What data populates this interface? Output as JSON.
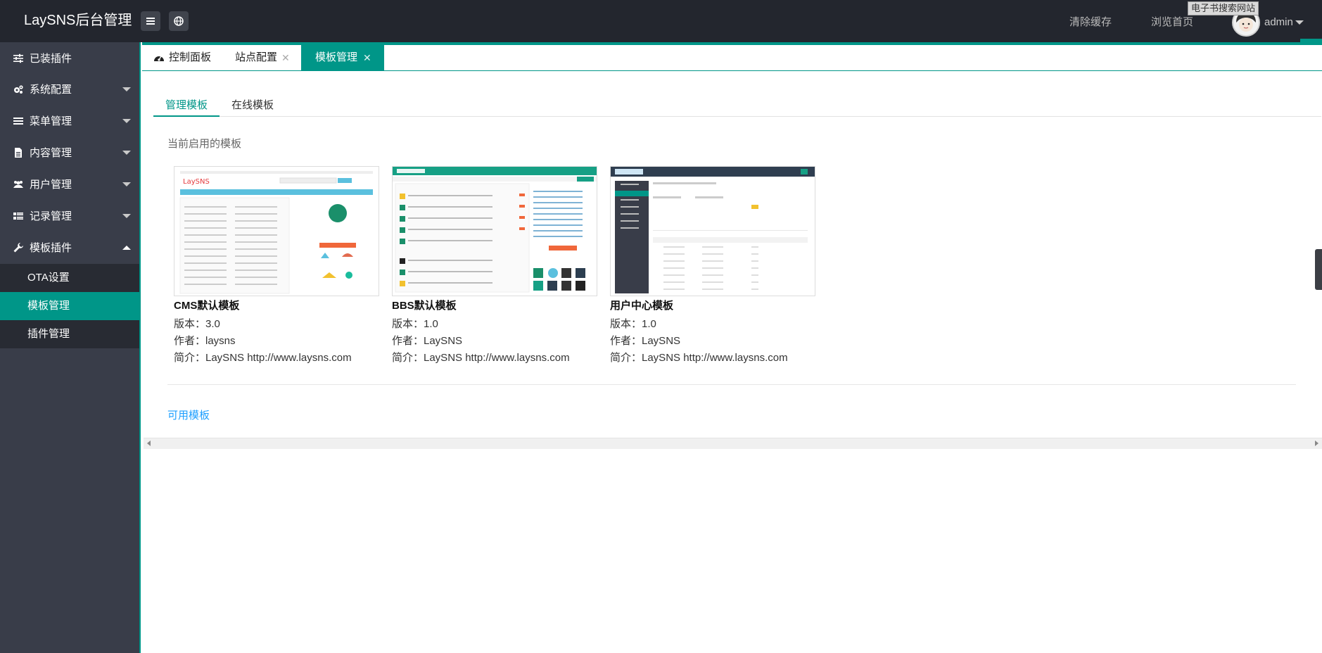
{
  "header": {
    "title": "LaySNS后台管理",
    "clear_cache": "清除缓存",
    "browse_home": "浏览首页",
    "watermark": "电子书搜索网站",
    "user": "admin"
  },
  "sidebar": {
    "items": [
      {
        "label": "已装插件",
        "icon": "sliders-icon",
        "has_caret": false
      },
      {
        "label": "系统配置",
        "icon": "gears-icon",
        "has_caret": true
      },
      {
        "label": "菜单管理",
        "icon": "list-icon",
        "has_caret": true
      },
      {
        "label": "内容管理",
        "icon": "file-icon",
        "has_caret": true
      },
      {
        "label": "用户管理",
        "icon": "users-icon",
        "has_caret": true
      },
      {
        "label": "记录管理",
        "icon": "grid-icon",
        "has_caret": true
      },
      {
        "label": "模板插件",
        "icon": "wrench-icon",
        "has_caret": true,
        "expanded": true
      }
    ],
    "sub_items": [
      {
        "label": "OTA设置",
        "active": false
      },
      {
        "label": "模板管理",
        "active": true
      },
      {
        "label": "插件管理",
        "active": false
      }
    ]
  },
  "tabs": [
    {
      "label": "控制面板",
      "closable": false,
      "active": false
    },
    {
      "label": "站点配置",
      "closable": true,
      "active": false
    },
    {
      "label": "模板管理",
      "closable": true,
      "active": true
    }
  ],
  "subtabs": [
    "管理模板",
    "在线模板"
  ],
  "current_section_title": "当前启用的模板",
  "available_section_title": "可用模板",
  "templates": [
    {
      "name": "CMS默认模板",
      "version": "版本：3.0",
      "author": "作者：laysns",
      "intro": "简介：LaySNS http://www.laysns.com"
    },
    {
      "name": "BBS默认模板",
      "version": "版本：1.0",
      "author": "作者：LaySNS",
      "intro": "简介：LaySNS http://www.laysns.com"
    },
    {
      "name": "用户中心模板",
      "version": "版本：1.0",
      "author": "作者：LaySNS",
      "intro": "简介：LaySNS http://www.laysns.com"
    }
  ],
  "colors": {
    "accent": "#009688",
    "sidebar": "#393d49",
    "header": "#23262e",
    "link": "#1e9fff"
  }
}
